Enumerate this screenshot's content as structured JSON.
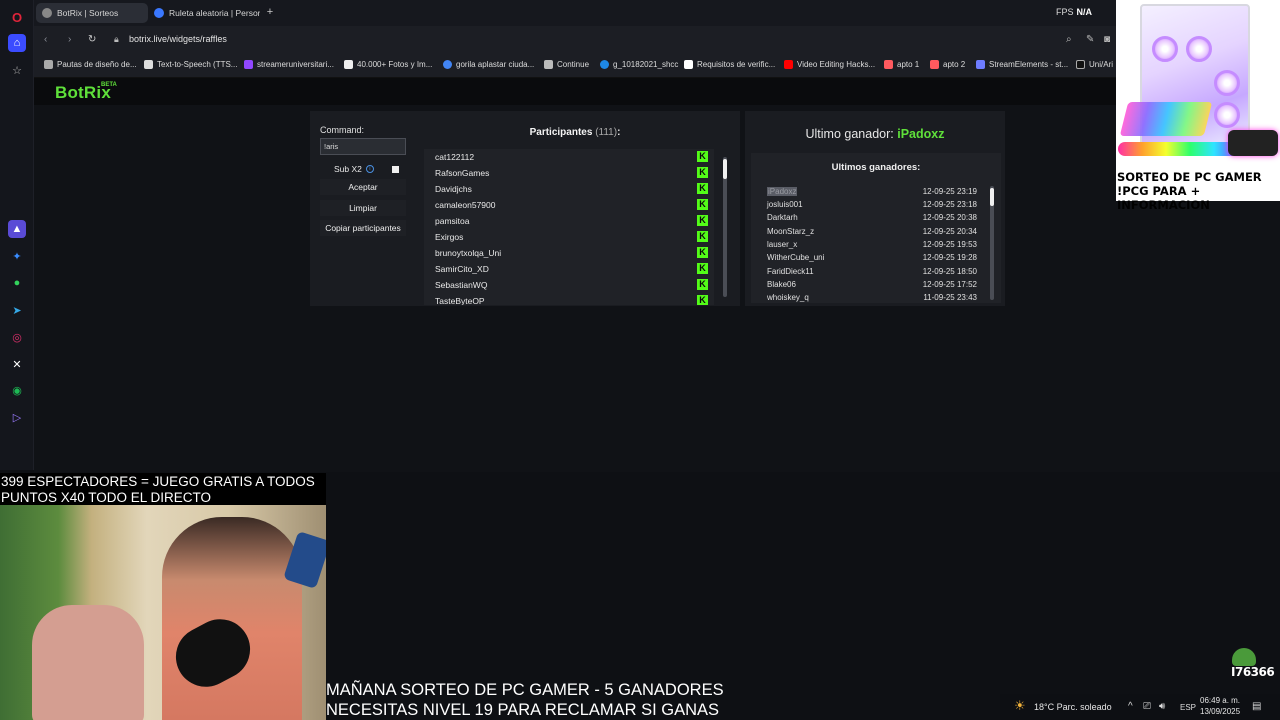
{
  "browser": {
    "tabs": [
      {
        "label": "BotRix | Sorteos",
        "active": true
      },
      {
        "label": "Ruleta aleatoria | Personal",
        "active": false
      }
    ],
    "url": "botrix.live/widgets/raffles",
    "fps_label": "FPS",
    "fps_value": "N/A",
    "bookmarks": [
      "Pautas de diseño de...",
      "Text-to-Speech (TTS...",
      "streameruniversitari...",
      "40.000+ Fotos y Im...",
      "gorila aplastar ciuda...",
      "Continue",
      "g_10182021_shcc",
      "Requisitos de verific...",
      "Video Editing Hacks...",
      "apto 1",
      "apto 2",
      "StreamElements - st...",
      "Uni/Ari"
    ]
  },
  "botrix": {
    "logo": "BotRix",
    "beta": "BETA"
  },
  "controls": {
    "command_label": "Command:",
    "command_value": "!aris",
    "sub_label": "Sub X2",
    "accept": "Aceptar",
    "clear": "Limpiar",
    "copy": "Copiar participantes"
  },
  "participants": {
    "title": "Participantes",
    "count": "(111)",
    "colon": ":",
    "list": [
      "cat122112",
      "RafsonGames",
      "Davidjchs",
      "camaleon57900",
      "pamsitoa",
      "Exirgos",
      "brunoytxolqa_Uni",
      "SamirCito_XD",
      "SebastianWQ",
      "TasteByteOP"
    ]
  },
  "winners": {
    "last_winner_label": "Ultimo ganador:",
    "last_winner": "iPadoxz",
    "list_title": "Ultimos ganadores:",
    "list": [
      {
        "name": "iPadoxz",
        "date": "12-09-25 23:19"
      },
      {
        "name": "josluis001",
        "date": "12-09-25 23:18"
      },
      {
        "name": "Darktarh",
        "date": "12-09-25 20:38"
      },
      {
        "name": "MoonStarz_z",
        "date": "12-09-25 20:34"
      },
      {
        "name": "lauser_x",
        "date": "12-09-25 19:53"
      },
      {
        "name": "WitherCube_uni",
        "date": "12-09-25 19:28"
      },
      {
        "name": "FaridDieck11",
        "date": "12-09-25 18:50"
      },
      {
        "name": "Blake06",
        "date": "12-09-25 17:52"
      },
      {
        "name": "whoiskey_q",
        "date": "11-09-25 23:43"
      }
    ]
  },
  "overlay": {
    "promo_line1": "SORTEO DE PC GAMER",
    "promo_line2": "!PCG PARA + INFORMACION",
    "cam_line1": "399 ESPECTADORES = JUEGO GRATIS A TODOS",
    "cam_line2": "PUNTOS X40 TODO EL DIRECTO",
    "bottom_line1": "MAÑANA SORTEO DE PC GAMER - 5 GANADORES",
    "bottom_line2": "NECESITAS NIVEL 19 PARA RECLAMAR SI GANAS",
    "badge": "I76366"
  },
  "taskbar": {
    "weather": "18°C Parc. soleado",
    "lang": "ESP",
    "time": "06:49 a. m.",
    "date": "13/09/2025"
  },
  "colors": {
    "accent_green": "#5fe03a",
    "kick_green": "#53fc18"
  }
}
